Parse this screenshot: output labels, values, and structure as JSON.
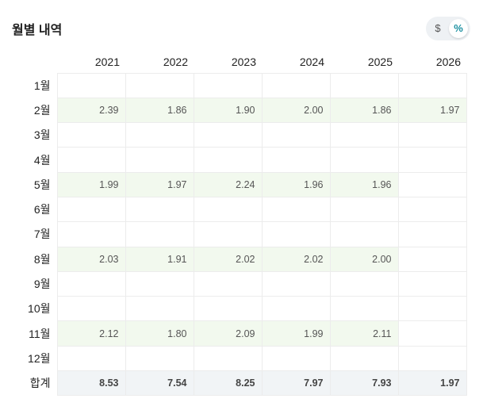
{
  "title": "월별 내역",
  "toggle": {
    "dollar_label": "$",
    "percent_label": "%",
    "selected": "percent"
  },
  "years": [
    "2021",
    "2022",
    "2023",
    "2024",
    "2025",
    "2026"
  ],
  "rows": [
    {
      "label": "1월",
      "values": [
        "",
        "",
        "",
        "",
        "",
        ""
      ]
    },
    {
      "label": "2월",
      "values": [
        "2.39",
        "1.86",
        "1.90",
        "2.00",
        "1.86",
        "1.97"
      ]
    },
    {
      "label": "3월",
      "values": [
        "",
        "",
        "",
        "",
        "",
        ""
      ]
    },
    {
      "label": "4월",
      "values": [
        "",
        "",
        "",
        "",
        "",
        ""
      ]
    },
    {
      "label": "5월",
      "values": [
        "1.99",
        "1.97",
        "2.24",
        "1.96",
        "1.96",
        ""
      ]
    },
    {
      "label": "6월",
      "values": [
        "",
        "",
        "",
        "",
        "",
        ""
      ]
    },
    {
      "label": "7월",
      "values": [
        "",
        "",
        "",
        "",
        "",
        ""
      ]
    },
    {
      "label": "8월",
      "values": [
        "2.03",
        "1.91",
        "2.02",
        "2.02",
        "2.00",
        ""
      ]
    },
    {
      "label": "9월",
      "values": [
        "",
        "",
        "",
        "",
        "",
        ""
      ]
    },
    {
      "label": "10월",
      "values": [
        "",
        "",
        "",
        "",
        "",
        ""
      ]
    },
    {
      "label": "11월",
      "values": [
        "2.12",
        "1.80",
        "2.09",
        "1.99",
        "2.11",
        ""
      ]
    },
    {
      "label": "12월",
      "values": [
        "",
        "",
        "",
        "",
        "",
        ""
      ]
    }
  ],
  "total": {
    "label": "합계",
    "values": [
      "8.53",
      "7.54",
      "8.25",
      "7.97",
      "7.93",
      "1.97"
    ]
  },
  "colors": {
    "highlight_row": "#f2f9ee",
    "total_row": "#f1f4f6",
    "accent": "#1a8fa0"
  }
}
